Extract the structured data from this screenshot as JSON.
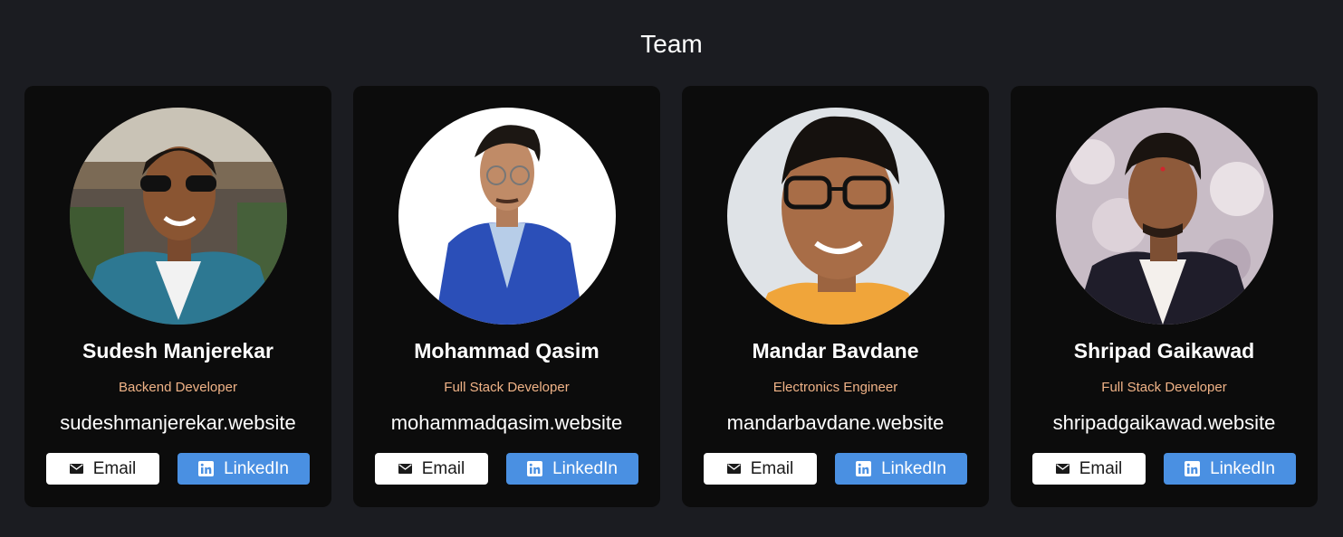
{
  "section": {
    "title": "Team"
  },
  "buttons": {
    "email_label": "Email",
    "linkedin_label": "LinkedIn"
  },
  "colors": {
    "background": "#1b1c21",
    "card": "#0c0c0c",
    "role_text": "#f0b387",
    "linkedin_button": "#4a90e2",
    "email_button": "#ffffff"
  },
  "members": [
    {
      "name": "Sudesh Manjerekar",
      "role": "Backend Developer",
      "website": "sudeshmanjerekar.website"
    },
    {
      "name": "Mohammad Qasim",
      "role": "Full Stack Developer",
      "website": "mohammadqasim.website"
    },
    {
      "name": "Mandar Bavdane",
      "role": "Electronics Engineer",
      "website": "mandarbavdane.website"
    },
    {
      "name": "Shripad Gaikawad",
      "role": "Full Stack Developer",
      "website": "shripadgaikawad.website"
    }
  ]
}
